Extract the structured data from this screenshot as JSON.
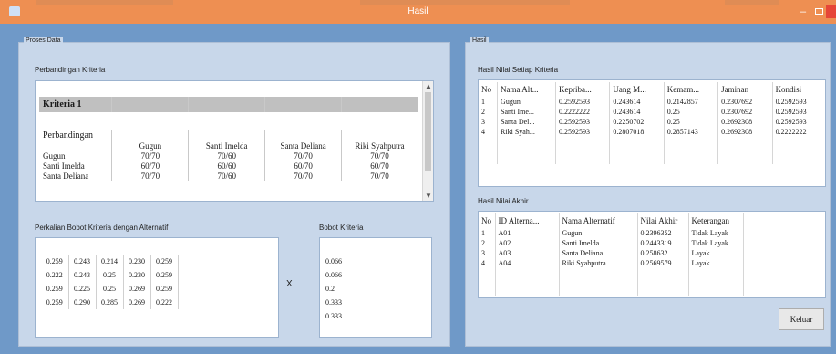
{
  "window": {
    "title": "Hasil",
    "minimize_glyph": "–"
  },
  "proses": {
    "group_label": "Proses Data",
    "perbandingan_label": "Perbandingan Kriteria",
    "criteria_header": "Kriteria 1",
    "subheader": "Perbandingan",
    "alternatives": [
      "Gugun",
      "Santi Imelda",
      "Santa Deliana",
      "Riki Syahputra"
    ],
    "rows": [
      {
        "name": "Gugun",
        "values": [
          "70/70",
          "70/60",
          "70/70",
          "70/70"
        ]
      },
      {
        "name": "Santi Imelda",
        "values": [
          "60/70",
          "60/60",
          "60/70",
          "60/70"
        ]
      },
      {
        "name": "Santa Deliana",
        "values": [
          "70/70",
          "70/60",
          "70/70",
          "70/70"
        ]
      }
    ],
    "perkalian_label": "Perkalian Bobot Kriteria dengan Alternatif",
    "matrix": [
      [
        "0.259",
        "0.243",
        "0.214",
        "0.230",
        "0.259"
      ],
      [
        "0.222",
        "0.243",
        "0.25",
        "0.230",
        "0.259"
      ],
      [
        "0.259",
        "0.225",
        "0.25",
        "0.269",
        "0.259"
      ],
      [
        "0.259",
        "0.290",
        "0.285",
        "0.269",
        "0.222"
      ]
    ],
    "multiply_symbol": "X",
    "bobot_label": "Bobot Kriteria",
    "bobot": [
      "0.066",
      "0.066",
      "0.2",
      "0.333",
      "0.333"
    ]
  },
  "hasil": {
    "group_label": "Hasil",
    "nilai_label": "Hasil Nilai Setiap Kriteria",
    "nilai_columns": [
      "No",
      "Nama Alt...",
      "Kepriba...",
      "Uang M...",
      "Kemam...",
      "Jaminan",
      "Kondisi"
    ],
    "nilai_rows": [
      [
        "1",
        "Gugun",
        "0.2592593",
        "0.243614",
        "0.2142857",
        "0.2307692",
        "0.2592593"
      ],
      [
        "2",
        "Santi Ime...",
        "0.2222222",
        "0.243614",
        "0.25",
        "0.2307692",
        "0.2592593"
      ],
      [
        "3",
        "Santa Del...",
        "0.2592593",
        "0.2250702",
        "0.25",
        "0.2692308",
        "0.2592593"
      ],
      [
        "4",
        "Riki Syah...",
        "0.2592593",
        "0.2807018",
        "0.2857143",
        "0.2692308",
        "0.2222222"
      ]
    ],
    "akhir_label": "Hasil Nilai Akhir",
    "akhir_columns": [
      "No",
      "ID Alterna...",
      "Nama Alternatif",
      "Nilai Akhir",
      "Keterangan"
    ],
    "akhir_rows": [
      [
        "1",
        "A01",
        "Gugun",
        "0.2396352",
        "Tidak Layak"
      ],
      [
        "2",
        "A02",
        "Santi Imelda",
        "0.2443319",
        "Tidak Layak"
      ],
      [
        "3",
        "A03",
        "Santa Deliana",
        "0.258632",
        "Layak"
      ],
      [
        "4",
        "A04",
        "Riki Syahputra",
        "0.2569579",
        "Layak"
      ]
    ],
    "keluar_label": "Keluar"
  }
}
